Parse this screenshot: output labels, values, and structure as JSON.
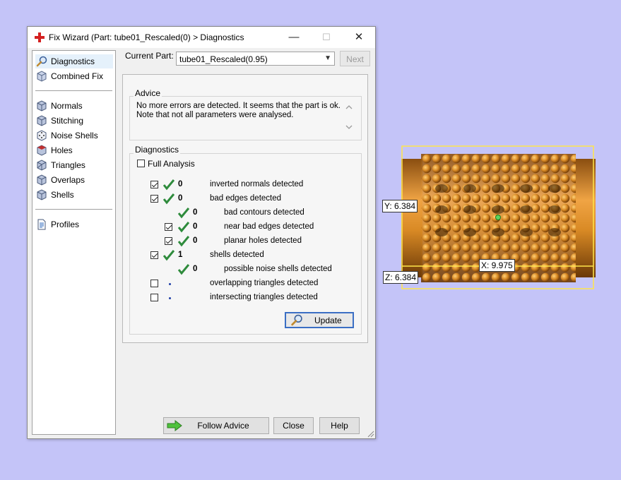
{
  "window": {
    "title": "Fix Wizard (Part: tube01_Rescaled(0) > Diagnostics",
    "minimize_glyph": "—",
    "maximize_glyph": "☐",
    "close_glyph": "✕"
  },
  "sidebar": {
    "items": [
      {
        "label": "Diagnostics",
        "icon": "magnifier-icon",
        "selected": true
      },
      {
        "label": "Combined Fix",
        "icon": "cube-icon"
      },
      {
        "label": "Normals",
        "icon": "cube-icon"
      },
      {
        "label": "Stitching",
        "icon": "cube-icon"
      },
      {
        "label": "Noise Shells",
        "icon": "dice-icon"
      },
      {
        "label": "Holes",
        "icon": "cube-icon"
      },
      {
        "label": "Triangles",
        "icon": "cube-icon"
      },
      {
        "label": "Overlaps",
        "icon": "cube-icon"
      },
      {
        "label": "Shells",
        "icon": "cube-icon"
      },
      {
        "label": "Profiles",
        "icon": "document-icon"
      }
    ]
  },
  "current_part": {
    "label": "Current Part:",
    "value": "tube01_Rescaled(0.95)",
    "next_label": "Next"
  },
  "advice": {
    "title": "Advice",
    "text_line1": "No more errors are detected. It seems that the part is ok.",
    "text_line2": "Note that not all parameters were analysed."
  },
  "diagnostics": {
    "title": "Diagnostics",
    "full_analysis_label": "Full Analysis",
    "full_analysis_checked": false,
    "rows": [
      {
        "checkbox": true,
        "checked": true,
        "status": "ok",
        "count": "0",
        "label": "inverted normals detected",
        "indent": 0
      },
      {
        "checkbox": true,
        "checked": true,
        "status": "ok",
        "count": "0",
        "label": "bad edges detected",
        "indent": 0
      },
      {
        "checkbox": false,
        "checked": false,
        "status": "ok",
        "count": "0",
        "label": "bad contours detected",
        "indent": 1
      },
      {
        "checkbox": true,
        "checked": true,
        "status": "ok",
        "count": "0",
        "label": "near bad edges detected",
        "indent": 1
      },
      {
        "checkbox": true,
        "checked": true,
        "status": "ok",
        "count": "0",
        "label": "planar holes detected",
        "indent": 1
      },
      {
        "checkbox": true,
        "checked": true,
        "status": "ok",
        "count": "1",
        "label": "shells detected",
        "indent": 0
      },
      {
        "checkbox": false,
        "checked": false,
        "status": "ok",
        "count": "0",
        "label": "possible noise shells detected",
        "indent": 1
      },
      {
        "checkbox": true,
        "checked": false,
        "status": "none",
        "count": "",
        "label": "overlapping triangles detected",
        "indent": 0
      },
      {
        "checkbox": true,
        "checked": false,
        "status": "none",
        "count": "",
        "label": "intersecting triangles detected",
        "indent": 0
      }
    ],
    "update_label": "Update"
  },
  "footer": {
    "follow_advice_label": "Follow Advice",
    "close_label": "Close",
    "help_label": "Help"
  },
  "viewport": {
    "y_label": "Y: 6.384",
    "x_label": "X: 9.975",
    "z_label": "Z: 6.384"
  },
  "colors": {
    "background": "#c4c4f8",
    "check_green": "#2e8b3c",
    "part_orange": "#d98a25",
    "bbox_yellow": "#ffe54a",
    "accent_blue": "#3b6fc4"
  }
}
